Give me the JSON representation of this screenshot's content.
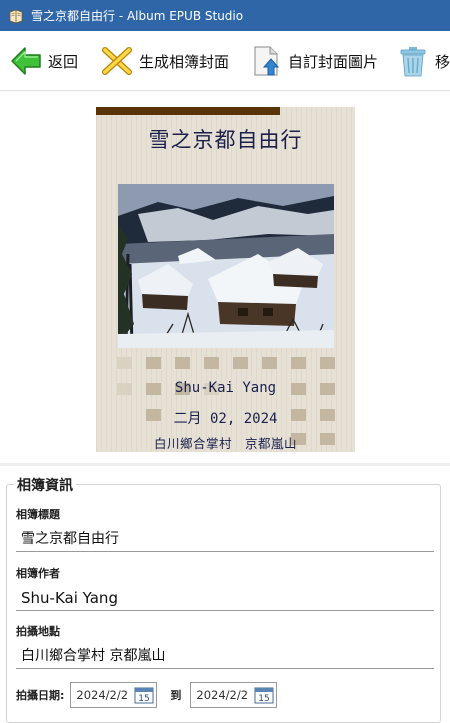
{
  "window": {
    "title": "雪之京都自由行 - Album EPUB Studio"
  },
  "toolbar": {
    "back_label": "返回",
    "generate_label": "生成相簿封面",
    "custom_label": "自訂封面圖片",
    "remove_label": "移"
  },
  "cover": {
    "title": "雪之京都自由行",
    "author": "Shu-Kai Yang",
    "date": "二月 02, 2024",
    "location": "白川鄉合掌村　京都嵐山"
  },
  "info": {
    "section_title": "相簿資訊",
    "title_label": "相簿標題",
    "title_value": "雪之京都自由行",
    "author_label": "相簿作者",
    "author_value": "Shu-Kai Yang",
    "location_label": "拍攝地點",
    "location_value": "白川鄉合掌村 京都嵐山",
    "date_label": "拍攝日期:",
    "date_from": "2024/2/2",
    "date_to_label": "到",
    "date_to": "2024/2/2",
    "calendar_day": "15"
  },
  "colors": {
    "titlebar": "#2f66a7",
    "cover_bg": "#e6e1d4",
    "cover_bar": "#5a3408",
    "cover_text": "#1c1f4a"
  }
}
